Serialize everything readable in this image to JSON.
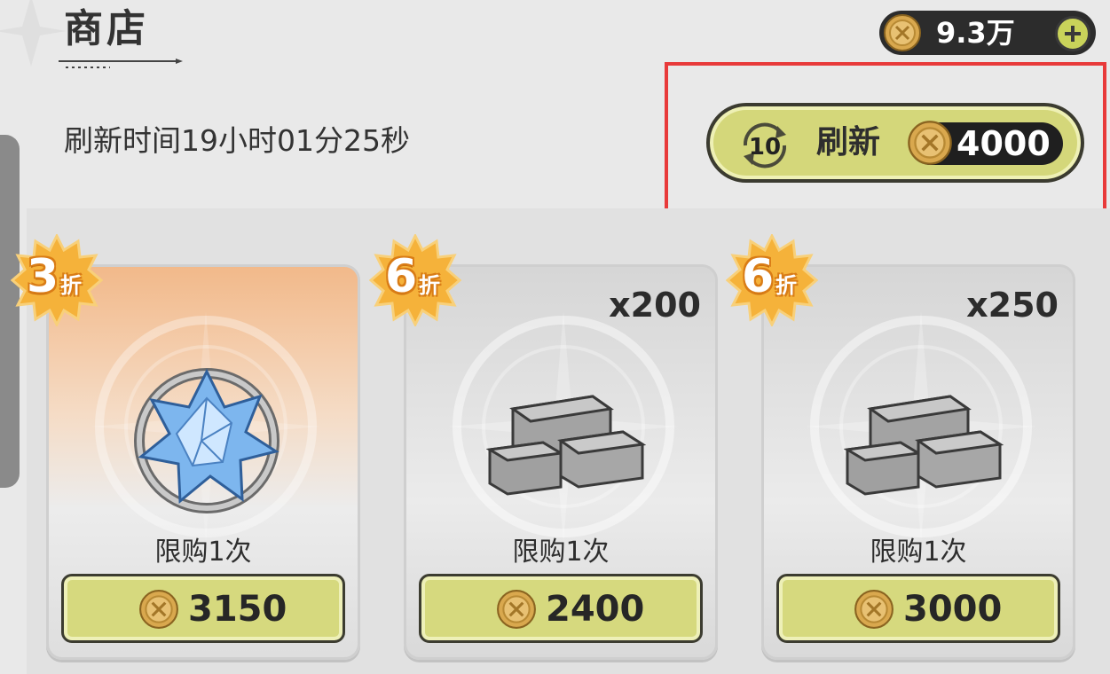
{
  "header": {
    "title": "商店"
  },
  "currency": {
    "amount": "9.3万",
    "icon": "gold-coin-icon"
  },
  "refresh": {
    "timer_text": "刷新时间19小时01分25秒",
    "count": "10",
    "label": "刷新",
    "cost": "4000"
  },
  "items": [
    {
      "discount_num": "3",
      "discount_unit": "折",
      "quantity": "",
      "limit": "限购1次",
      "price": "3150",
      "icon": "blue-crystal-icon"
    },
    {
      "discount_num": "6",
      "discount_unit": "折",
      "quantity": "x200",
      "limit": "限购1次",
      "price": "2400",
      "icon": "stone-bricks-icon"
    },
    {
      "discount_num": "6",
      "discount_unit": "折",
      "quantity": "x250",
      "limit": "限购1次",
      "price": "3000",
      "icon": "stone-bricks-icon"
    }
  ],
  "colors": {
    "accent_button": "#d6d97e",
    "highlight_border": "#e83a3a",
    "discount_badge": "#f5b23a"
  }
}
